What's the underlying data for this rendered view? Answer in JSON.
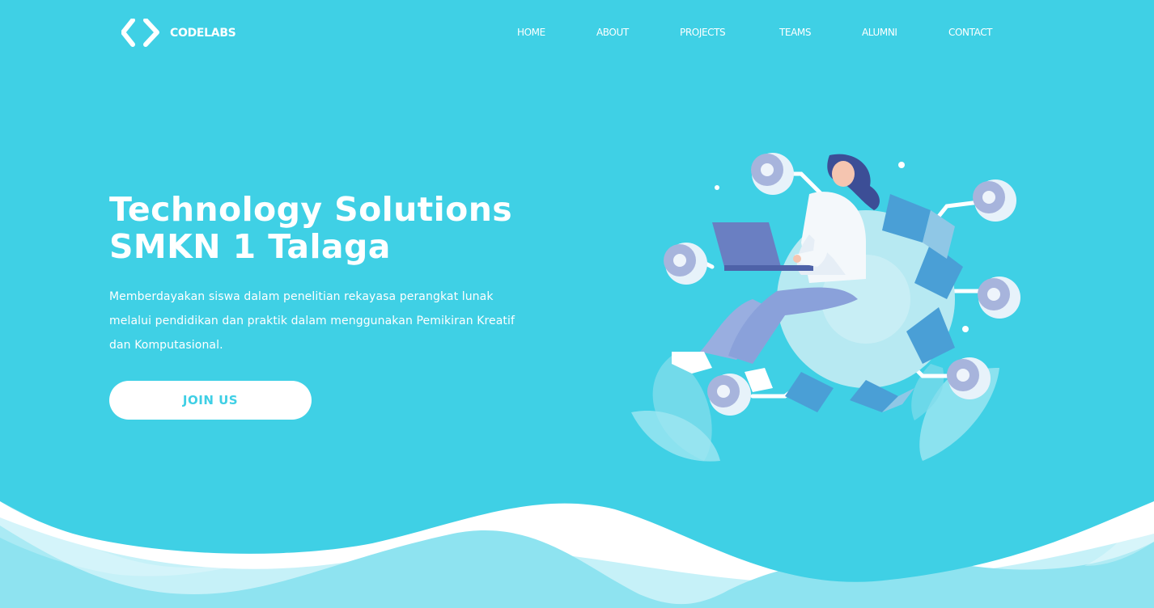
{
  "brand": {
    "name": "CODELABS",
    "logo_icon": "code-brackets-icon"
  },
  "nav": {
    "items": [
      {
        "label": "HOME"
      },
      {
        "label": "ABOUT"
      },
      {
        "label": "PROJECTS"
      },
      {
        "label": "TEAMS"
      },
      {
        "label": "ALUMNI"
      },
      {
        "label": "CONTACT"
      }
    ]
  },
  "hero": {
    "title_line1": "Technology Solutions",
    "title_line2": "SMKN 1 Talaga",
    "description": "Memberdayakan siswa dalam penelitian rekayasa perangkat lunak melalui pendidikan dan praktik dalam menggunakan Pemikiran Kreatif dan Komputasional.",
    "cta_label": "JOIN US",
    "illustration": "person-with-laptop-on-gear-icon"
  },
  "colors": {
    "primary": "#3fd0e5",
    "wave_light": "#8ee3f0",
    "wave_pale": "#c6f1f8",
    "text_on_primary": "#ffffff",
    "button_text": "#3fcfe5"
  }
}
